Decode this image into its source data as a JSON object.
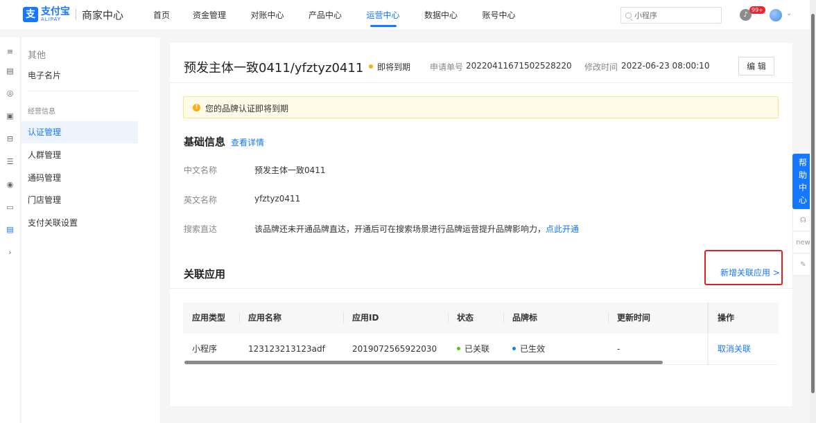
{
  "header": {
    "logo_cn": "支付宝",
    "logo_en": "ALIPAY",
    "product_title": "商家中心",
    "nav": [
      {
        "label": "首页"
      },
      {
        "label": "资金管理"
      },
      {
        "label": "对账中心"
      },
      {
        "label": "产品中心"
      },
      {
        "label": "运营中心"
      },
      {
        "label": "数据中心"
      },
      {
        "label": "账号中心"
      }
    ],
    "active_nav": "运营中心",
    "search_placeholder": "小程序",
    "notification_badge": "99+"
  },
  "sidebar": {
    "group_other": "其他",
    "item_card": "电子名片",
    "group_business": "经营信息",
    "items": [
      {
        "label": "认证管理"
      },
      {
        "label": "人群管理"
      },
      {
        "label": "通码管理"
      },
      {
        "label": "门店管理"
      },
      {
        "label": "支付关联设置"
      }
    ],
    "active_item": "认证管理"
  },
  "detail": {
    "title": "预发主体一致0411/yfztyz0411",
    "status": "即将到期",
    "apply_no_label": "申请单号",
    "apply_no": "20220411671502528220",
    "modified_label": "修改时间",
    "modified_time": "2022-06-23 08:00:10",
    "edit_label": "编 辑",
    "alert": "您的品牌认证即将到期",
    "basic_title": "基础信息",
    "basic_link": "查看详情",
    "fields": {
      "cn_name_label": "中文名称",
      "cn_name": "预发主体一致0411",
      "en_name_label": "英文名称",
      "en_name": "yfztyz0411",
      "search_label": "搜索直达",
      "search_text": "该品牌还未开通品牌直达，开通后可在搜索场景进行品牌运营提升品牌影响力，",
      "search_link": "点此开通"
    },
    "related_title": "关联应用",
    "add_related": "新增关联应用 >"
  },
  "table": {
    "columns": [
      "应用类型",
      "应用名称",
      "应用ID",
      "状态",
      "品牌标",
      "更新时间",
      "操作"
    ],
    "rows": [
      {
        "type": "小程序",
        "name": "123123213123adf",
        "app_id": "2019072565922030",
        "status": "已关联",
        "brand": "已生效",
        "updated": "-",
        "action": "取消关联"
      }
    ]
  },
  "help": {
    "label_1": "帮",
    "label_2": "助",
    "label_3": "中",
    "label_4": "心",
    "new_label": "new"
  },
  "colors": {
    "brand": "#1677ff",
    "warning": "#faad14",
    "success": "#52c41a",
    "highlight": "#e02020"
  }
}
